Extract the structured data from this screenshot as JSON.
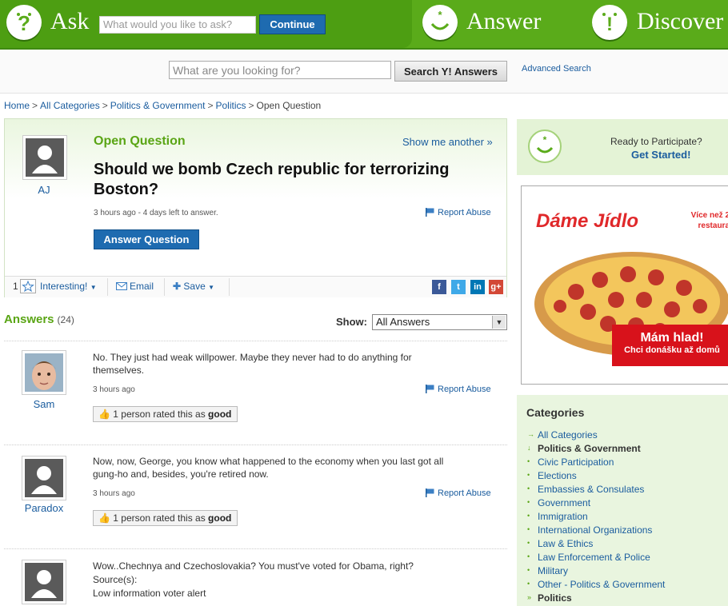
{
  "header": {
    "ask_label": "Ask",
    "ask_placeholder": "What would you like to ask?",
    "continue_label": "Continue",
    "answer_label": "Answer",
    "discover_label": "Discover"
  },
  "search": {
    "placeholder": "What are you looking for?",
    "button_label": "Search Y! Answers",
    "advanced_label": "Advanced Search"
  },
  "breadcrumb": {
    "items": [
      "Home",
      "All Categories",
      "Politics & Government",
      "Politics"
    ],
    "current": "Open Question"
  },
  "question": {
    "author": "AJ",
    "type": "Open Question",
    "show_another": "Show me another »",
    "title": "Should we bomb Czech republic for terrorizing Boston?",
    "meta": "3 hours ago - 4 days left to answer.",
    "report": "Report Abuse",
    "answer_button": "Answer Question",
    "toolbar": {
      "interesting_count": "1",
      "interesting_label": "Interesting!",
      "email_label": "Email",
      "save_label": "Save"
    }
  },
  "answers": {
    "title": "Answers",
    "count": "(24)",
    "show_label": "Show:",
    "show_value": "All Answers",
    "items": [
      {
        "name": "Sam",
        "text": "No. They just had weak willpower. Maybe they never had to do anything for themselves.",
        "meta": "3 hours ago",
        "report": "Report Abuse",
        "rated_prefix": "1 person rated this as",
        "rated_value": "good"
      },
      {
        "name": "Paradox",
        "text": "Now, now, George, you know what happened to the economy when you last got all gung-ho and, besides, you're retired now.",
        "meta": "3 hours ago",
        "report": "Report Abuse",
        "rated_prefix": "1 person rated this as",
        "rated_value": "good"
      },
      {
        "name": "",
        "text": "Wow..Chechnya and Czechoslovakia? You must've voted for Obama, right?",
        "source_label": "Source(s):",
        "source_text": "Low information voter alert"
      }
    ]
  },
  "sidebar": {
    "participate_line1": "Ready to Participate?",
    "participate_line2": "Get Started!",
    "ad": {
      "brand": "Dáme Jídlo",
      "tagline": "Více než 2 restaura",
      "headline": "Mám hlad!",
      "subline": "Chci donášku až domů"
    },
    "categories_title": "Categories",
    "categories": [
      {
        "label": "All Categories",
        "bullet": "→"
      },
      {
        "label": "Politics & Government",
        "bullet": "↓",
        "bold": true
      },
      {
        "label": "Civic Participation",
        "bullet": "•"
      },
      {
        "label": "Elections",
        "bullet": "•"
      },
      {
        "label": "Embassies & Consulates",
        "bullet": "•"
      },
      {
        "label": "Government",
        "bullet": "•"
      },
      {
        "label": "Immigration",
        "bullet": "•"
      },
      {
        "label": "International Organizations",
        "bullet": "•"
      },
      {
        "label": "Law & Ethics",
        "bullet": "•"
      },
      {
        "label": "Law Enforcement & Police",
        "bullet": "•"
      },
      {
        "label": "Military",
        "bullet": "•"
      },
      {
        "label": "Other - Politics & Government",
        "bullet": "•"
      },
      {
        "label": "Politics",
        "bullet": "»",
        "bold": true
      }
    ]
  },
  "colors": {
    "brand_green": "#5aab1a",
    "link_blue": "#1a5c9e",
    "button_blue": "#1e6bb0"
  }
}
